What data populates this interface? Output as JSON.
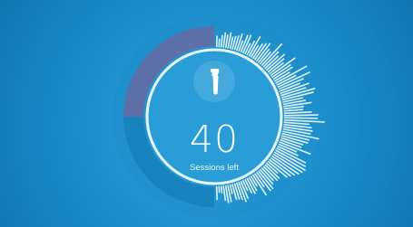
{
  "sessions": {
    "count": "40",
    "label": "Sessions left",
    "remaining_fraction": 0.5
  },
  "icon": {
    "name": "brush-head-icon"
  },
  "colors": {
    "background": "#1f93cf",
    "ring_used": "#6a6aa2",
    "ring_remaining": "#1884bd",
    "bars": "#dff3fb"
  }
}
